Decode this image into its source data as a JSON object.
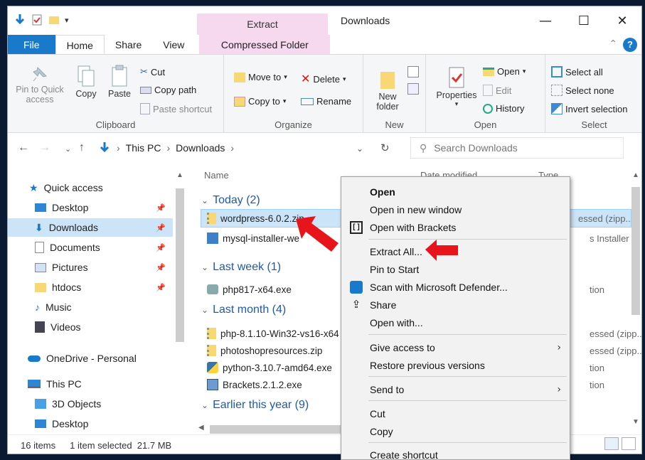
{
  "window": {
    "context_tab": "Extract",
    "title": "Downloads",
    "controls": [
      "—",
      "☐",
      "✕"
    ]
  },
  "tabs": [
    "File",
    "Home",
    "Share",
    "View",
    "Compressed Folder Tools"
  ],
  "ribbon": {
    "clipboard": {
      "pin": "Pin to Quick access",
      "copy": "Copy",
      "paste": "Paste",
      "cut": "Cut",
      "copy_path": "Copy path",
      "paste_shortcut": "Paste shortcut",
      "label": "Clipboard"
    },
    "organize": {
      "move_to": "Move to",
      "delete": "Delete",
      "copy_to": "Copy to",
      "rename": "Rename",
      "label": "Organize"
    },
    "new": {
      "new_folder": "New folder",
      "label": "New"
    },
    "open": {
      "properties": "Properties",
      "open": "Open",
      "edit": "Edit",
      "history": "History",
      "label": "Open"
    },
    "select": {
      "select_all": "Select all",
      "select_none": "Select none",
      "invert": "Invert selection",
      "label": "Select"
    }
  },
  "address": {
    "path": [
      "This PC",
      "Downloads"
    ],
    "search_placeholder": "Search Downloads"
  },
  "sidebar": {
    "items": [
      {
        "label": "Quick access",
        "icon": "star-icon"
      },
      {
        "label": "Desktop",
        "icon": "desktop-icon"
      },
      {
        "label": "Downloads",
        "icon": "download-icon"
      },
      {
        "label": "Documents",
        "icon": "documents-icon"
      },
      {
        "label": "Pictures",
        "icon": "pictures-icon"
      },
      {
        "label": "htdocs",
        "icon": "folder-icon"
      },
      {
        "label": "Music",
        "icon": "music-icon"
      },
      {
        "label": "Videos",
        "icon": "videos-icon"
      },
      {
        "label": "OneDrive - Personal",
        "icon": "cloud-icon"
      },
      {
        "label": "This PC",
        "icon": "pc-icon"
      },
      {
        "label": "3D Objects",
        "icon": "3d-icon"
      },
      {
        "label": "Desktop",
        "icon": "desktop-icon"
      }
    ]
  },
  "list": {
    "columns": {
      "name": "Name",
      "date": "Date modified",
      "type": "Type"
    },
    "groups": [
      {
        "label": "Today (2)"
      },
      {
        "label": "Last week (1)"
      },
      {
        "label": "Last month (4)"
      },
      {
        "label": "Earlier this year (9)"
      }
    ],
    "files": [
      {
        "name": "wordpress-6.0.2.zip",
        "type": "essed (zipp..."
      },
      {
        "name": "mysql-installer-we",
        "type": "s Installer ..."
      },
      {
        "name": "php817-x64.exe",
        "type": "tion"
      },
      {
        "name": "php-8.1.10-Win32-vs16-x64",
        "type": "essed (zipp..."
      },
      {
        "name": "photoshopresources.zip",
        "type": "essed (zipp..."
      },
      {
        "name": "python-3.10.7-amd64.exe",
        "type": "tion"
      },
      {
        "name": "Brackets.2.1.2.exe",
        "type": "tion"
      }
    ]
  },
  "status": {
    "count": "16 items",
    "selection": "1 item selected  21.7 MB"
  },
  "context_menu": {
    "items": [
      "Open",
      "Open in new window",
      "Open with Brackets",
      "Extract All...",
      "Pin to Start",
      "Scan with Microsoft Defender...",
      "Share",
      "Open with...",
      "Give access to",
      "Restore previous versions",
      "Send to",
      "Cut",
      "Copy",
      "Create shortcut"
    ]
  },
  "colors": {
    "accent": "#1979ca",
    "selection": "#cce4f7",
    "group_text": "#1e5aa8",
    "annotation_arrow": "#e8141c"
  }
}
